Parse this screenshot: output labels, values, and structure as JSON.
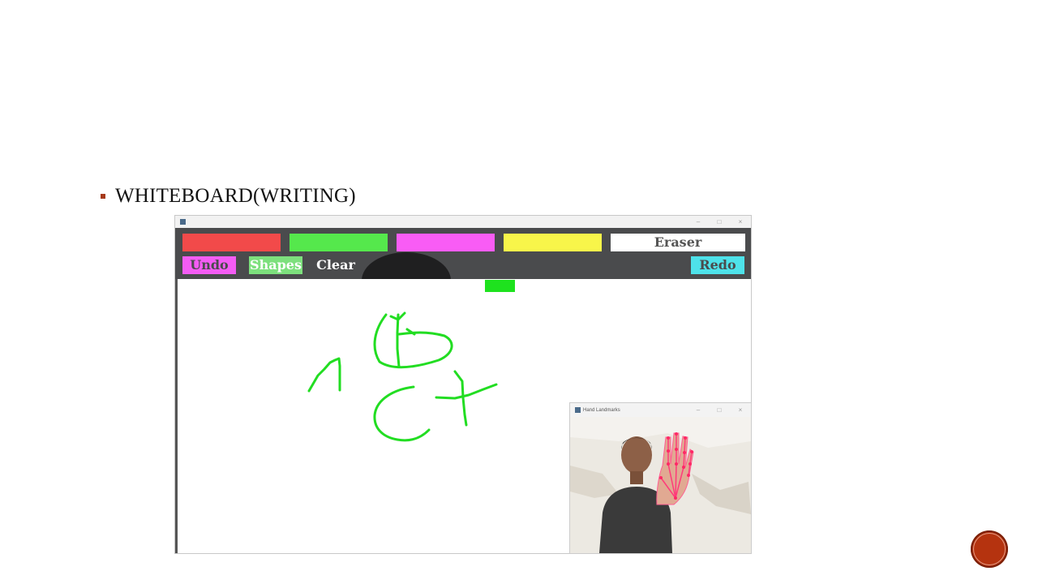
{
  "slide": {
    "heading": "WHITEBOARD(WRITING)",
    "bullet_color": "#a63a1a",
    "accent_color": "#b5330f"
  },
  "painter": {
    "toolbar_bg": "#4a4b4d",
    "colors": [
      {
        "name": "red",
        "hex": "#f24a4a"
      },
      {
        "name": "green",
        "hex": "#55e84c"
      },
      {
        "name": "magenta",
        "hex": "#f95cf5"
      },
      {
        "name": "yellow",
        "hex": "#f8f54a"
      }
    ],
    "eraser_label": "Eraser",
    "undo_label": "Undo",
    "shapes_label": "Shapes",
    "clear_label": "Clear",
    "redo_label": "Redo",
    "stroke_color": "#22dd22",
    "active_color_indicator": "#1ee21e"
  },
  "camera_window": {
    "title": "Hand Landmarks",
    "minimize_icon": "minimize-icon",
    "maximize_icon": "maximize-icon",
    "close_icon": "close-icon"
  }
}
